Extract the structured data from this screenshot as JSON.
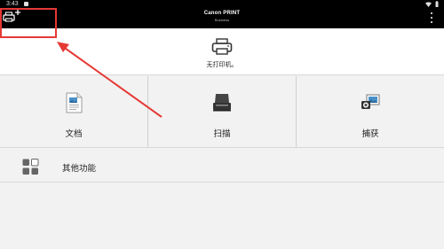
{
  "status_bar": {
    "time": "3:43"
  },
  "app_bar": {
    "title": "Canon PRINT",
    "subtitle": "Business"
  },
  "printer": {
    "label": "无打印机。"
  },
  "tiles": [
    {
      "label": "文档",
      "icon": "document-icon"
    },
    {
      "label": "扫描",
      "icon": "scanner-icon"
    },
    {
      "label": "捕获",
      "icon": "camera-capture-icon"
    }
  ],
  "other": {
    "label": "其他功能",
    "icon": "grid-apps-icon"
  },
  "colors": {
    "annotation": "#e53935",
    "topbar": "#000000",
    "background": "#f2f2f2"
  }
}
